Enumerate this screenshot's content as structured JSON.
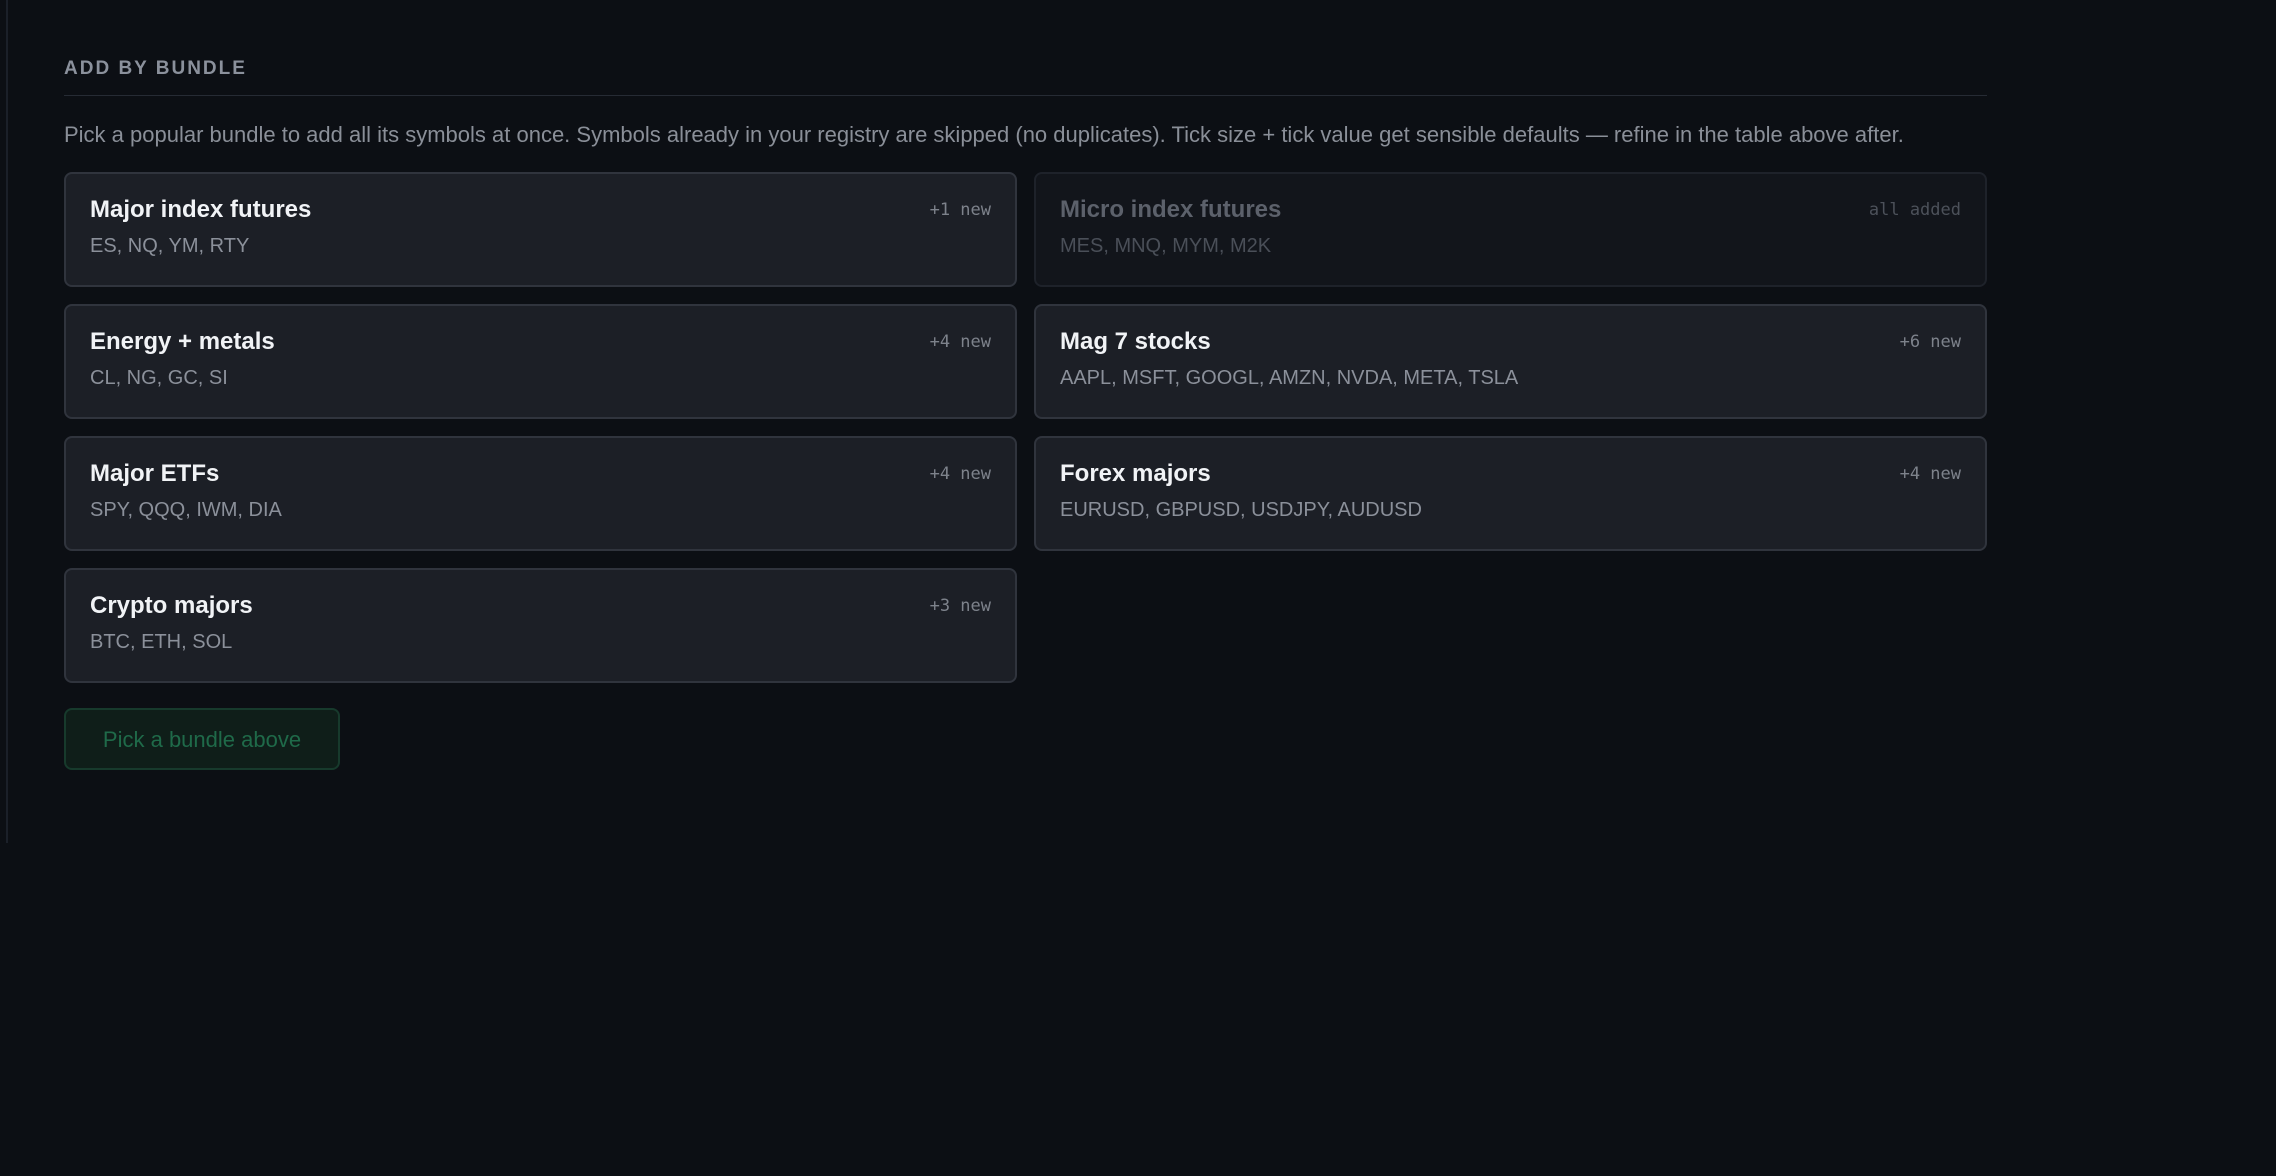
{
  "section": {
    "heading": "ADD BY BUNDLE",
    "description": "Pick a popular bundle to add all its symbols at once. Symbols already in your registry are skipped (no duplicates). Tick size + tick value get sensible defaults — refine in the table above after."
  },
  "bundles": [
    {
      "title": "Major index futures",
      "symbols": "ES, NQ, YM, RTY",
      "badge": "+1 new",
      "disabled": false
    },
    {
      "title": "Micro index futures",
      "symbols": "MES, MNQ, MYM, M2K",
      "badge": "all added",
      "disabled": true
    },
    {
      "title": "Energy + metals",
      "symbols": "CL, NG, GC, SI",
      "badge": "+4 new",
      "disabled": false
    },
    {
      "title": "Mag 7 stocks",
      "symbols": "AAPL, MSFT, GOOGL, AMZN, NVDA, META, TSLA",
      "badge": "+6 new",
      "disabled": false
    },
    {
      "title": "Major ETFs",
      "symbols": "SPY, QQQ, IWM, DIA",
      "badge": "+4 new",
      "disabled": false
    },
    {
      "title": "Forex majors",
      "symbols": "EURUSD, GBPUSD, USDJPY, AUDUSD",
      "badge": "+4 new",
      "disabled": false
    },
    {
      "title": "Crypto majors",
      "symbols": "BTC, ETH, SOL",
      "badge": "+3 new",
      "disabled": false
    }
  ],
  "action": {
    "button_label": "Pick a bundle above"
  }
}
